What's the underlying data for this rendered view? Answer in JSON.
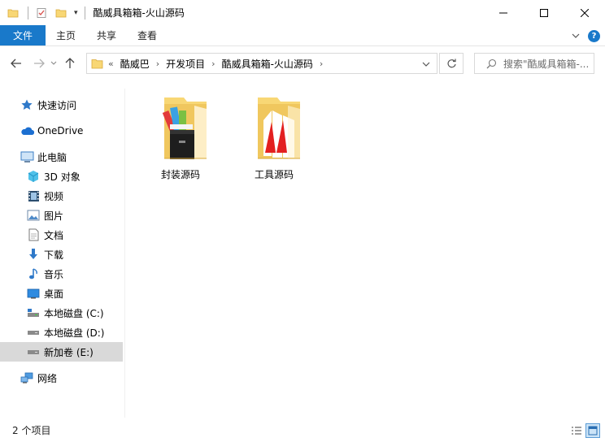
{
  "window": {
    "title": "酷威具箱箱-火山源码"
  },
  "ribbon": {
    "tabs": [
      "文件",
      "主页",
      "共享",
      "查看"
    ]
  },
  "address": {
    "prefix": "«",
    "crumbs": [
      "酷威巴",
      "开发项目",
      "酷威具箱箱-火山源码"
    ]
  },
  "search": {
    "placeholder": "搜索\"酷威具箱箱-..."
  },
  "sidebar": {
    "items": [
      {
        "label": "快速访问",
        "icon": "star-icon"
      },
      {
        "label": "OneDrive",
        "icon": "cloud-icon"
      },
      {
        "label": "此电脑",
        "icon": "computer-icon"
      },
      {
        "label": "3D 对象",
        "icon": "cube-icon"
      },
      {
        "label": "视频",
        "icon": "video-icon"
      },
      {
        "label": "图片",
        "icon": "picture-icon"
      },
      {
        "label": "文档",
        "icon": "document-icon"
      },
      {
        "label": "下载",
        "icon": "download-icon"
      },
      {
        "label": "音乐",
        "icon": "music-icon"
      },
      {
        "label": "桌面",
        "icon": "desktop-icon"
      },
      {
        "label": "本地磁盘 (C:)",
        "icon": "drive-icon"
      },
      {
        "label": "本地磁盘 (D:)",
        "icon": "drive-icon"
      },
      {
        "label": "新加卷 (E:)",
        "icon": "drive-icon"
      },
      {
        "label": "网络",
        "icon": "network-icon"
      }
    ]
  },
  "files": [
    {
      "name": "封装源码",
      "icon": "folder-books-icon"
    },
    {
      "name": "工具源码",
      "icon": "folder-tools-icon"
    }
  ],
  "status": {
    "count": "2 个项目"
  },
  "colors": {
    "accent": "#1979ca",
    "folder": "#f8d775",
    "folder_dark": "#e8b84a",
    "selected": "#d9d9d9"
  }
}
